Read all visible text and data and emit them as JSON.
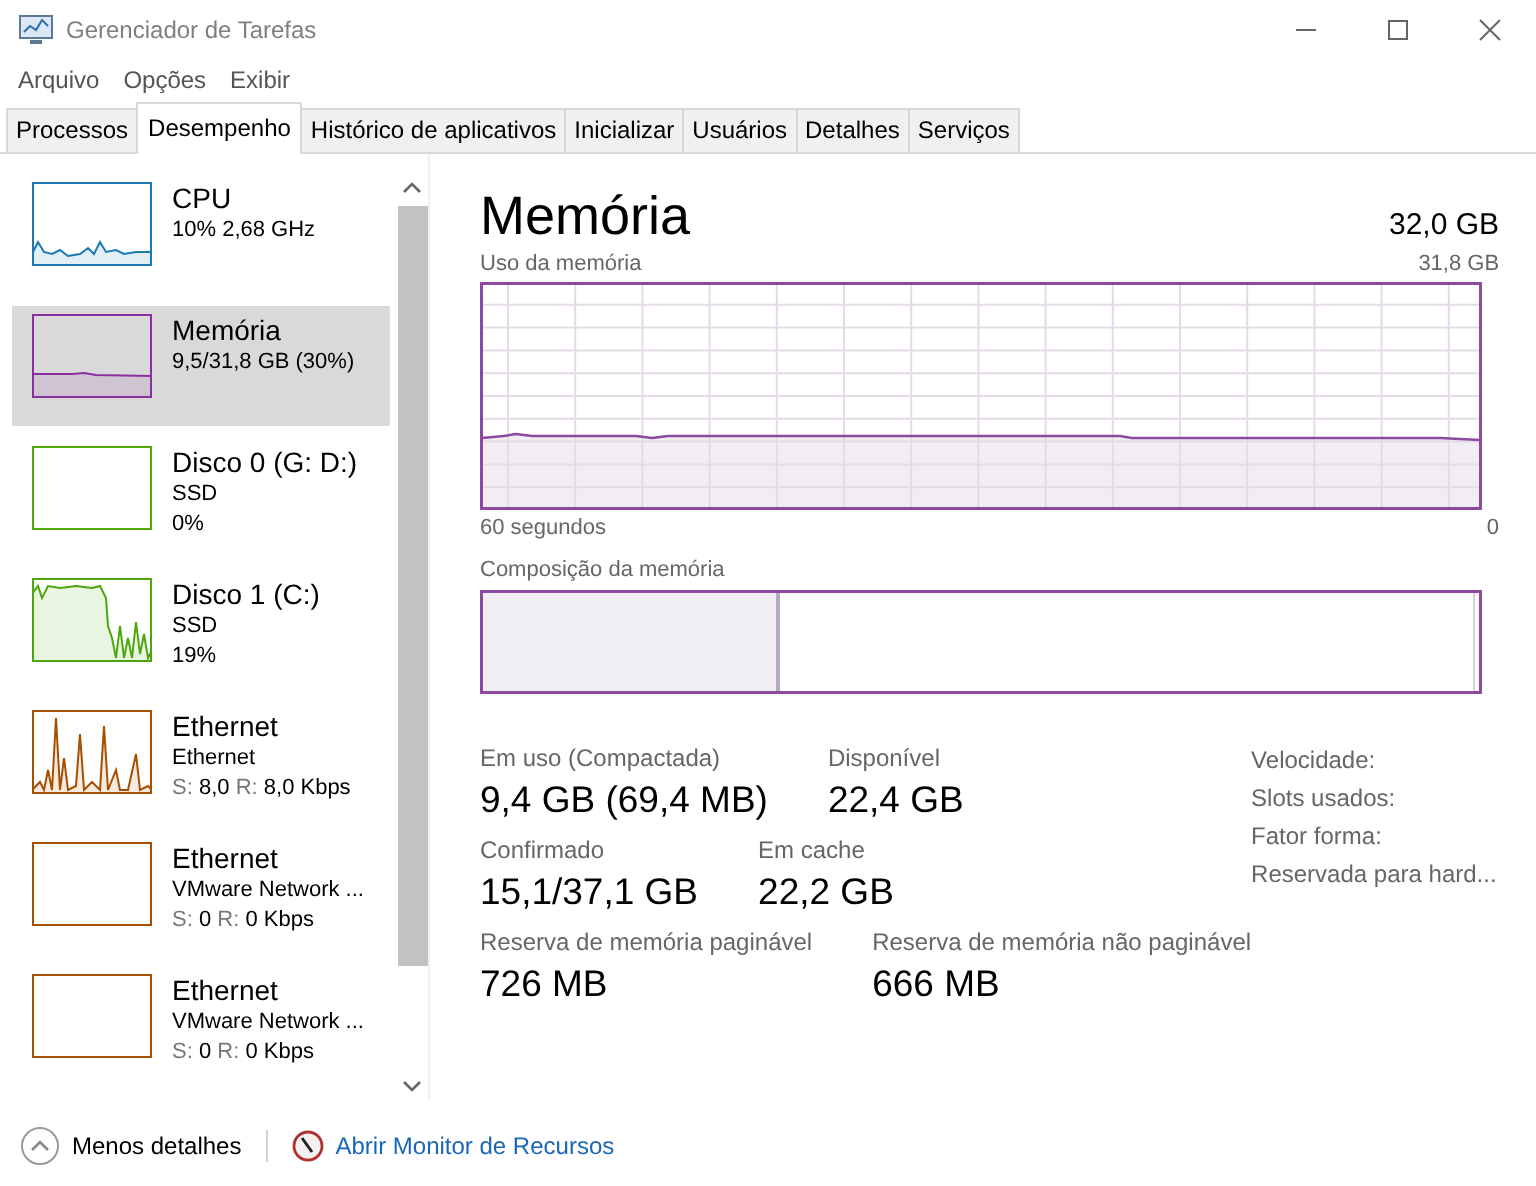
{
  "window": {
    "title": "Gerenciador de Tarefas"
  },
  "menu": [
    "Arquivo",
    "Opções",
    "Exibir"
  ],
  "tabs": [
    {
      "label": "Processos",
      "selected": false
    },
    {
      "label": "Desempenho",
      "selected": true
    },
    {
      "label": "Histórico de aplicativos",
      "selected": false
    },
    {
      "label": "Inicializar",
      "selected": false
    },
    {
      "label": "Usuários",
      "selected": false
    },
    {
      "label": "Detalhes",
      "selected": false
    },
    {
      "label": "Serviços",
      "selected": false
    }
  ],
  "sidebar": {
    "items": [
      {
        "kind": "cpu",
        "title": "CPU",
        "subtitles": [
          "10% 2,68 GHz"
        ],
        "color": "#1b7ab3",
        "selected": false
      },
      {
        "kind": "memory",
        "title": "Memória",
        "subtitles": [
          "9,5/31,8 GB (30%)"
        ],
        "color": "#8b2fa0",
        "selected": true
      },
      {
        "kind": "disk-idle",
        "title": "Disco 0 (G: D:)",
        "subtitles": [
          "SSD",
          "0%"
        ],
        "color": "#4da60c",
        "selected": false
      },
      {
        "kind": "disk-busy",
        "title": "Disco 1 (C:)",
        "subtitles": [
          "SSD",
          "19%"
        ],
        "color": "#4da60c",
        "selected": false
      },
      {
        "kind": "network-busy",
        "title": "Ethernet",
        "subtitles": [
          "Ethernet"
        ],
        "rate": {
          "send_label": "S:",
          "send": "8,0",
          "receive_label": "R:",
          "receive": "8,0 Kbps"
        },
        "color": "#a74f01",
        "selected": false
      },
      {
        "kind": "network-idle",
        "title": "Ethernet",
        "subtitles": [
          "VMware Network ..."
        ],
        "rate": {
          "send_label": "S:",
          "send": "0",
          "receive_label": "R:",
          "receive": "0 Kbps"
        },
        "color": "#a74f01",
        "selected": false
      },
      {
        "kind": "network-idle",
        "title": "Ethernet",
        "subtitles": [
          "VMware Network ..."
        ],
        "rate": {
          "send_label": "S:",
          "send": "0",
          "receive_label": "R:",
          "receive": "0 Kbps"
        },
        "color": "#a74f01",
        "selected": false
      }
    ]
  },
  "main": {
    "title": "Memória",
    "total": "32,0 GB",
    "usage_chart": {
      "label": "Uso da memória",
      "max": "31,8 GB",
      "time_span": "60 segundos",
      "end": "0"
    },
    "composition": {
      "label": "Composição da memória"
    },
    "stat_rows": [
      [
        {
          "label": "Em uso (Compactada)",
          "value": "9,4 GB (69,4 MB)"
        },
        {
          "label": "Disponível",
          "value": "22,4 GB"
        }
      ],
      [
        {
          "label": "Confirmado",
          "value": "15,1/37,1 GB"
        },
        {
          "label": "Em cache",
          "value": "22,2 GB"
        }
      ],
      [
        {
          "label": "Reserva de memória paginável",
          "value": "726 MB"
        },
        {
          "label": "Reserva de memória não paginável",
          "value": "666 MB"
        }
      ]
    ],
    "details": [
      "Velocidade:",
      "Slots usados:",
      "Fator forma:",
      "Reservada para hard..."
    ]
  },
  "footer": {
    "less_details": "Menos detalhes",
    "resource_monitor": "Abrir Monitor de Recursos"
  }
}
